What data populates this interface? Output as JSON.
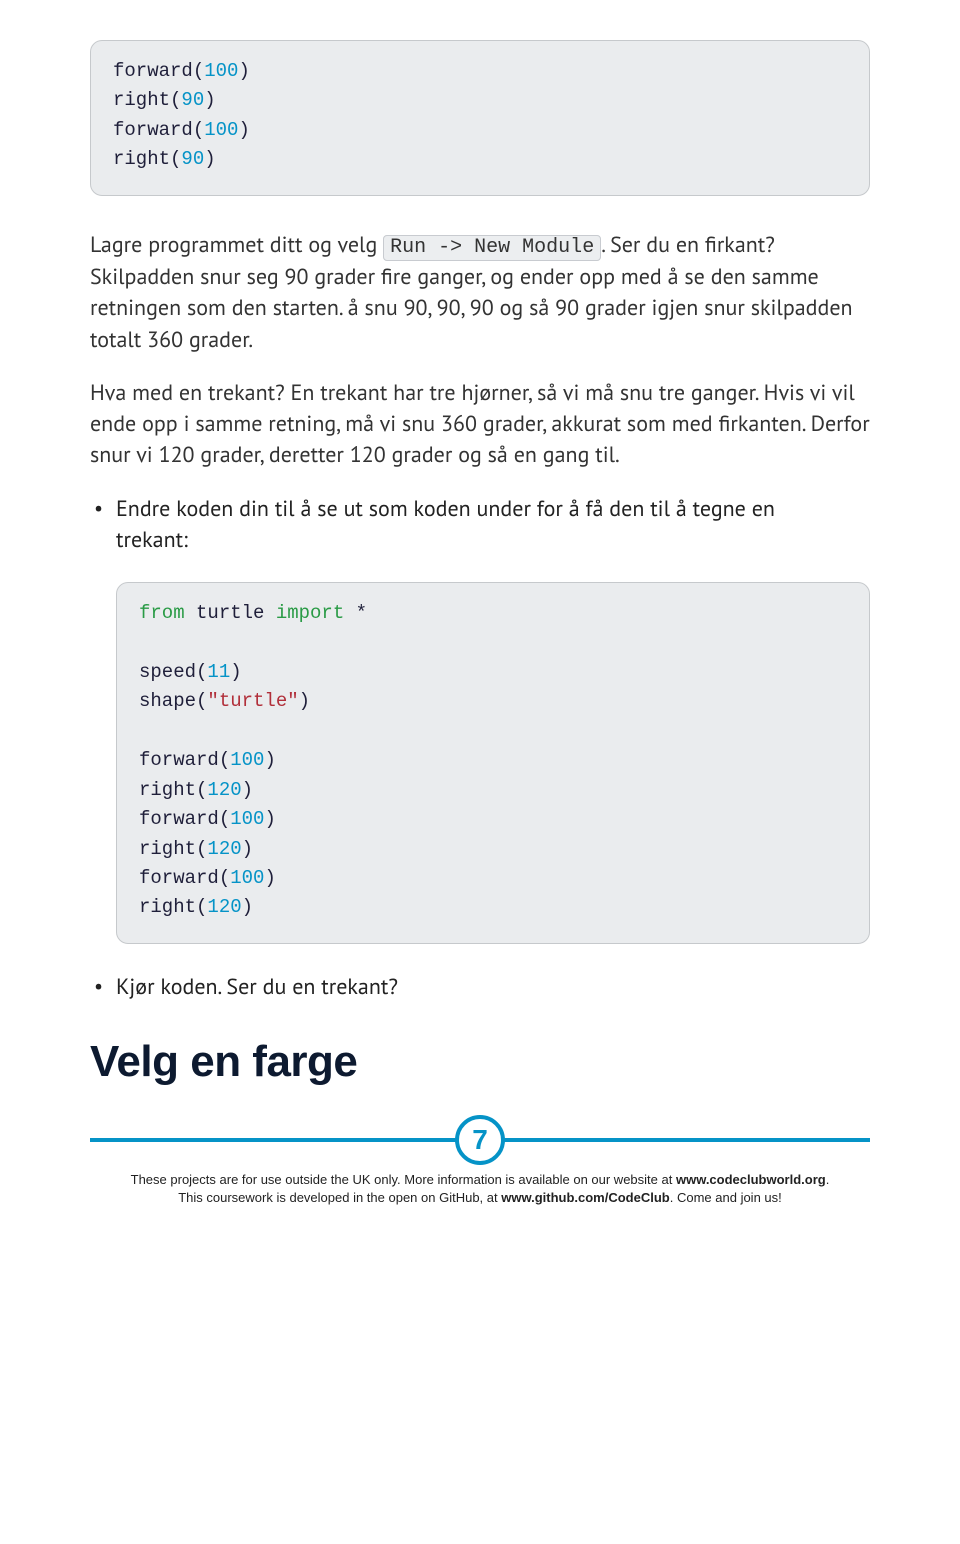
{
  "code_top": [
    [
      {
        "t": "fn",
        "v": "forward("
      },
      {
        "t": "num",
        "v": "100"
      },
      {
        "t": "fn",
        "v": ")"
      }
    ],
    [
      {
        "t": "fn",
        "v": "right("
      },
      {
        "t": "num",
        "v": "90"
      },
      {
        "t": "fn",
        "v": ")"
      }
    ],
    [
      {
        "t": "fn",
        "v": "forward("
      },
      {
        "t": "num",
        "v": "100"
      },
      {
        "t": "fn",
        "v": ")"
      }
    ],
    [
      {
        "t": "fn",
        "v": "right("
      },
      {
        "t": "num",
        "v": "90"
      },
      {
        "t": "fn",
        "v": ")"
      }
    ]
  ],
  "para1_a": "Lagre programmet ditt og velg ",
  "para1_code": "Run -> New Module",
  "para1_b": ". Ser du en firkant? Skilpadden snur seg 90 grader fire ganger, og ender opp med å se den samme retningen som den starten. å snu 90, 90, 90 og så 90 grader igjen snur skilpadden totalt 360 grader.",
  "para2": "Hva med en trekant? En trekant har tre hjørner, så vi må snu tre ganger. Hvis vi vil ende opp i samme retning, må vi snu 360 grader, akkurat som med firkanten. Derfor snur vi 120 grader, deretter 120 grader og så en gang til.",
  "bullet1_a": "Endre koden din til å se ut som koden under for å få den til å tegne en",
  "bullet1_b": "trekant:",
  "code_bot": [
    [
      {
        "t": "kw",
        "v": "from"
      },
      {
        "t": "fn",
        "v": " turtle "
      },
      {
        "t": "kw",
        "v": "import"
      },
      {
        "t": "fn",
        "v": " *"
      }
    ],
    [],
    [
      {
        "t": "fn",
        "v": "speed("
      },
      {
        "t": "num",
        "v": "11"
      },
      {
        "t": "fn",
        "v": ")"
      }
    ],
    [
      {
        "t": "fn",
        "v": "shape("
      },
      {
        "t": "str",
        "v": "\"turtle\""
      },
      {
        "t": "fn",
        "v": ")"
      }
    ],
    [],
    [
      {
        "t": "fn",
        "v": "forward("
      },
      {
        "t": "num",
        "v": "100"
      },
      {
        "t": "fn",
        "v": ")"
      }
    ],
    [
      {
        "t": "fn",
        "v": "right("
      },
      {
        "t": "num",
        "v": "120"
      },
      {
        "t": "fn",
        "v": ")"
      }
    ],
    [
      {
        "t": "fn",
        "v": "forward("
      },
      {
        "t": "num",
        "v": "100"
      },
      {
        "t": "fn",
        "v": ")"
      }
    ],
    [
      {
        "t": "fn",
        "v": "right("
      },
      {
        "t": "num",
        "v": "120"
      },
      {
        "t": "fn",
        "v": ")"
      }
    ],
    [
      {
        "t": "fn",
        "v": "forward("
      },
      {
        "t": "num",
        "v": "100"
      },
      {
        "t": "fn",
        "v": ")"
      }
    ],
    [
      {
        "t": "fn",
        "v": "right("
      },
      {
        "t": "num",
        "v": "120"
      },
      {
        "t": "fn",
        "v": ")"
      }
    ]
  ],
  "bullet2": "Kjør koden. Ser du en trekant?",
  "heading": "Velg en farge",
  "page_number": "7",
  "footer_line1_a": "These projects are for use outside the UK only. More information is available on our website at ",
  "footer_line1_b": "www.codeclubworld.org",
  "footer_line1_c": ".",
  "footer_line2_a": "This coursework is developed in the open on GitHub, at ",
  "footer_line2_b": "www.github.com/CodeClub",
  "footer_line2_c": ". Come and join us!"
}
